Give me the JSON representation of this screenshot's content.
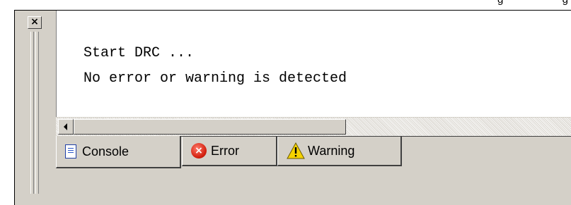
{
  "top_fragment": "g                    g",
  "panel": {
    "close_glyph": "×"
  },
  "console": {
    "lines": [
      "Start DRC ...",
      "No error or warning is detected"
    ]
  },
  "tabs": [
    {
      "label": "Console",
      "icon": "document-icon",
      "active": true
    },
    {
      "label": "Error",
      "icon": "error-icon",
      "active": false
    },
    {
      "label": "Warning",
      "icon": "warning-icon",
      "active": false
    }
  ],
  "colors": {
    "panel_bg": "#d4d0c8",
    "output_bg": "#ffffff",
    "error_red": "#d3200f",
    "warning_yellow": "#f5d300"
  }
}
